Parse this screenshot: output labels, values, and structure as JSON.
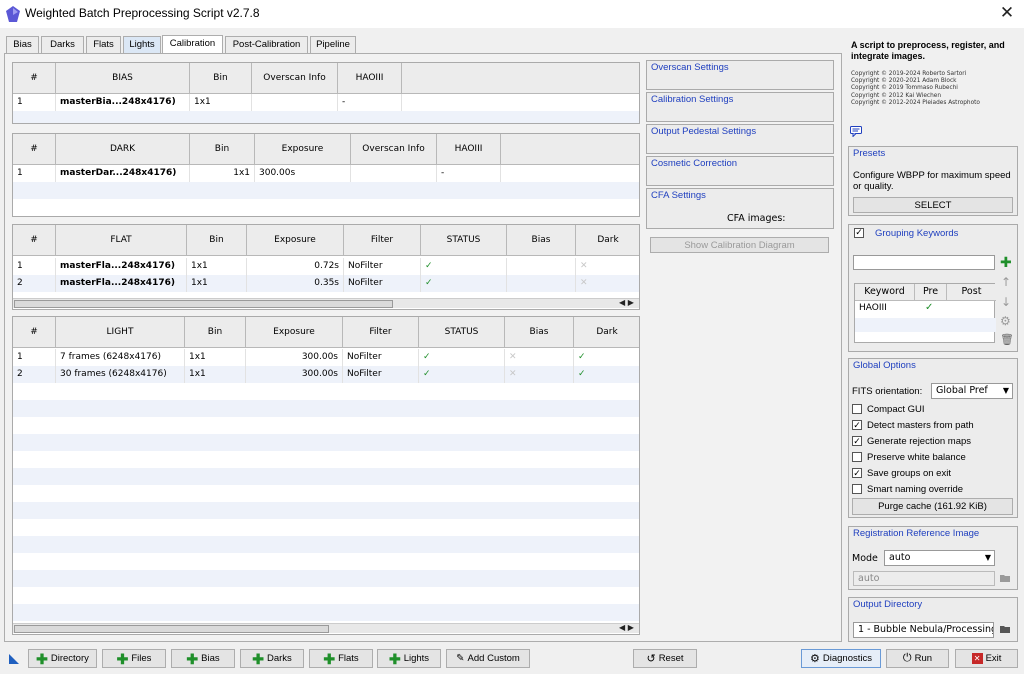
{
  "window": {
    "title": "Weighted Batch Preprocessing Script v2.7.8",
    "close": "✕"
  },
  "tabs": [
    "Bias",
    "Darks",
    "Flats",
    "Lights",
    "Calibration",
    "Post-Calibration",
    "Pipeline"
  ],
  "bias_table": {
    "headers": [
      "#",
      "BIAS",
      "Bin",
      "Overscan Info",
      "HAOIII"
    ],
    "rows": [
      {
        "n": "1",
        "name": "masterBia...248x4176)",
        "bin": "1x1",
        "overscan": "",
        "filter": "-"
      }
    ]
  },
  "dark_table": {
    "headers": [
      "#",
      "DARK",
      "Bin",
      "Exposure",
      "Overscan Info",
      "HAOIII"
    ],
    "rows": [
      {
        "n": "1",
        "name": "masterDar...248x4176)",
        "bin": "1x1",
        "exposure": "300.00s",
        "overscan": "",
        "filter": "-"
      }
    ]
  },
  "flat_table": {
    "headers": [
      "#",
      "FLAT",
      "Bin",
      "Exposure",
      "Filter",
      "STATUS",
      "Bias",
      "Dark"
    ],
    "rows": [
      {
        "n": "1",
        "name": "masterFla...248x4176)",
        "bin": "1x1",
        "exposure": "0.72s",
        "filter": "NoFilter"
      },
      {
        "n": "2",
        "name": "masterFla...248x4176)",
        "bin": "1x1",
        "exposure": "0.35s",
        "filter": "NoFilter"
      }
    ]
  },
  "light_table": {
    "headers": [
      "#",
      "LIGHT",
      "Bin",
      "Exposure",
      "Filter",
      "STATUS",
      "Bias",
      "Dark"
    ],
    "rows": [
      {
        "n": "1",
        "name": "7 frames (6248x4176)",
        "bin": "1x1",
        "exposure": "300.00s",
        "filter": "NoFilter"
      },
      {
        "n": "2",
        "name": "30 frames (6248x4176)",
        "bin": "1x1",
        "exposure": "300.00s",
        "filter": "NoFilter"
      }
    ]
  },
  "settings": {
    "overscan": "Overscan Settings",
    "calibration": "Calibration Settings",
    "pedestal": "Output Pedestal Settings",
    "cosmetic": "Cosmetic Correction",
    "cfa": "CFA Settings",
    "cfa_images": "CFA images:",
    "diagram": "Show Calibration Diagram"
  },
  "info": {
    "heading": "A script to preprocess, register, and integrate images.",
    "copyright": [
      "Copyright © 2019-2024 Roberto Sartori",
      "Copyright © 2020-2021 Adam Block",
      "Copyright © 2019 Tommaso Rubechi",
      "Copyright © 2012 Kai Wiechen",
      "Copyright © 2012-2024 Pleiades Astrophoto"
    ]
  },
  "presets": {
    "title": "Presets",
    "desc": "Configure WBPP for maximum speed or quality.",
    "button": "SELECT"
  },
  "grouping": {
    "title": "Grouping Keywords",
    "input": "",
    "headers": [
      "Keyword",
      "Pre",
      "Post"
    ],
    "row": {
      "keyword": "HAOIII",
      "pre": "✓",
      "post": ""
    }
  },
  "global": {
    "title": "Global Options",
    "fits_label": "FITS orientation:",
    "fits_value": "Global Pref",
    "options": [
      {
        "label": "Compact GUI",
        "checked": false
      },
      {
        "label": "Detect masters from path",
        "checked": true
      },
      {
        "label": "Generate rejection maps",
        "checked": true
      },
      {
        "label": "Preserve white balance",
        "checked": false
      },
      {
        "label": "Save groups on exit",
        "checked": true
      },
      {
        "label": "Smart naming override",
        "checked": false
      }
    ],
    "purge": "Purge cache (161.92 KiB)"
  },
  "registration": {
    "title": "Registration Reference Image",
    "mode_label": "Mode",
    "mode_value": "auto",
    "ref_value": "auto"
  },
  "output": {
    "title": "Output Directory",
    "value": "1 - Bubble Nebula/Processing"
  },
  "bottom": {
    "buttons": [
      "Directory",
      "Files",
      "Bias",
      "Darks",
      "Flats",
      "Lights"
    ],
    "add_custom": "Add Custom",
    "reset": "Reset",
    "diagnostics": "Diagnostics",
    "run": "Run",
    "exit": "Exit"
  },
  "colors": {
    "accent": "#1f3fbf",
    "check": "#1f8f2a",
    "exit": "#c62828"
  }
}
